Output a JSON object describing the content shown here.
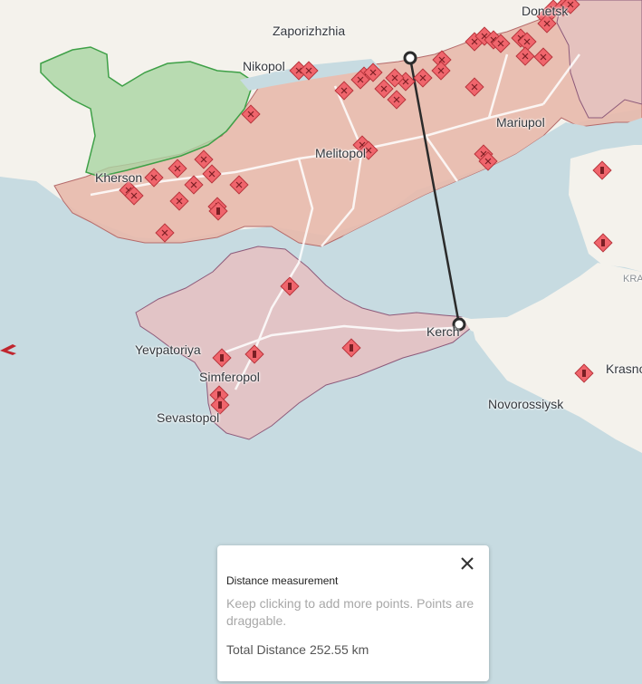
{
  "map": {
    "cities": [
      {
        "name": "Zaporizhzhia",
        "cls": "big"
      },
      {
        "name": "Nikopol",
        "cls": "big"
      },
      {
        "name": "Donetsk",
        "cls": "big"
      },
      {
        "name": "Kherson",
        "cls": "big"
      },
      {
        "name": "Melitopol",
        "cls": "big"
      },
      {
        "name": "Mariupol",
        "cls": "big"
      },
      {
        "name": "Yevpatoriya",
        "cls": "big"
      },
      {
        "name": "Simferopol",
        "cls": "big"
      },
      {
        "name": "Sevastopol",
        "cls": "big"
      },
      {
        "name": "Kerch",
        "cls": "big"
      },
      {
        "name": "Novorossiysk",
        "cls": "big"
      },
      {
        "name": "Krasnodar",
        "cls": "big"
      },
      {
        "name": "KRA",
        "cls": "small"
      }
    ],
    "colors": {
      "sea": "#c7dbe1",
      "land": "#f4f2ec",
      "occupied_mainland": "#e8b9ac",
      "crimea": "#e2c4c6",
      "liberated_green": "#a9d4a2",
      "green_border": "#3ea047",
      "marker_fill": "#f0656c",
      "marker_stroke": "#b7343b",
      "measure_line": "#2b2b2b"
    },
    "icons": [
      "explosion-marker-icon",
      "missile-marker-icon",
      "aircraft-icon",
      "measure-point-icon"
    ]
  },
  "measurement_panel": {
    "title": "Distance measurement",
    "hint": "Keep clicking to add more points. Points are draggable.",
    "total_label": "Total Distance",
    "total_value": "252.55 km",
    "close_icon": "close-icon"
  }
}
